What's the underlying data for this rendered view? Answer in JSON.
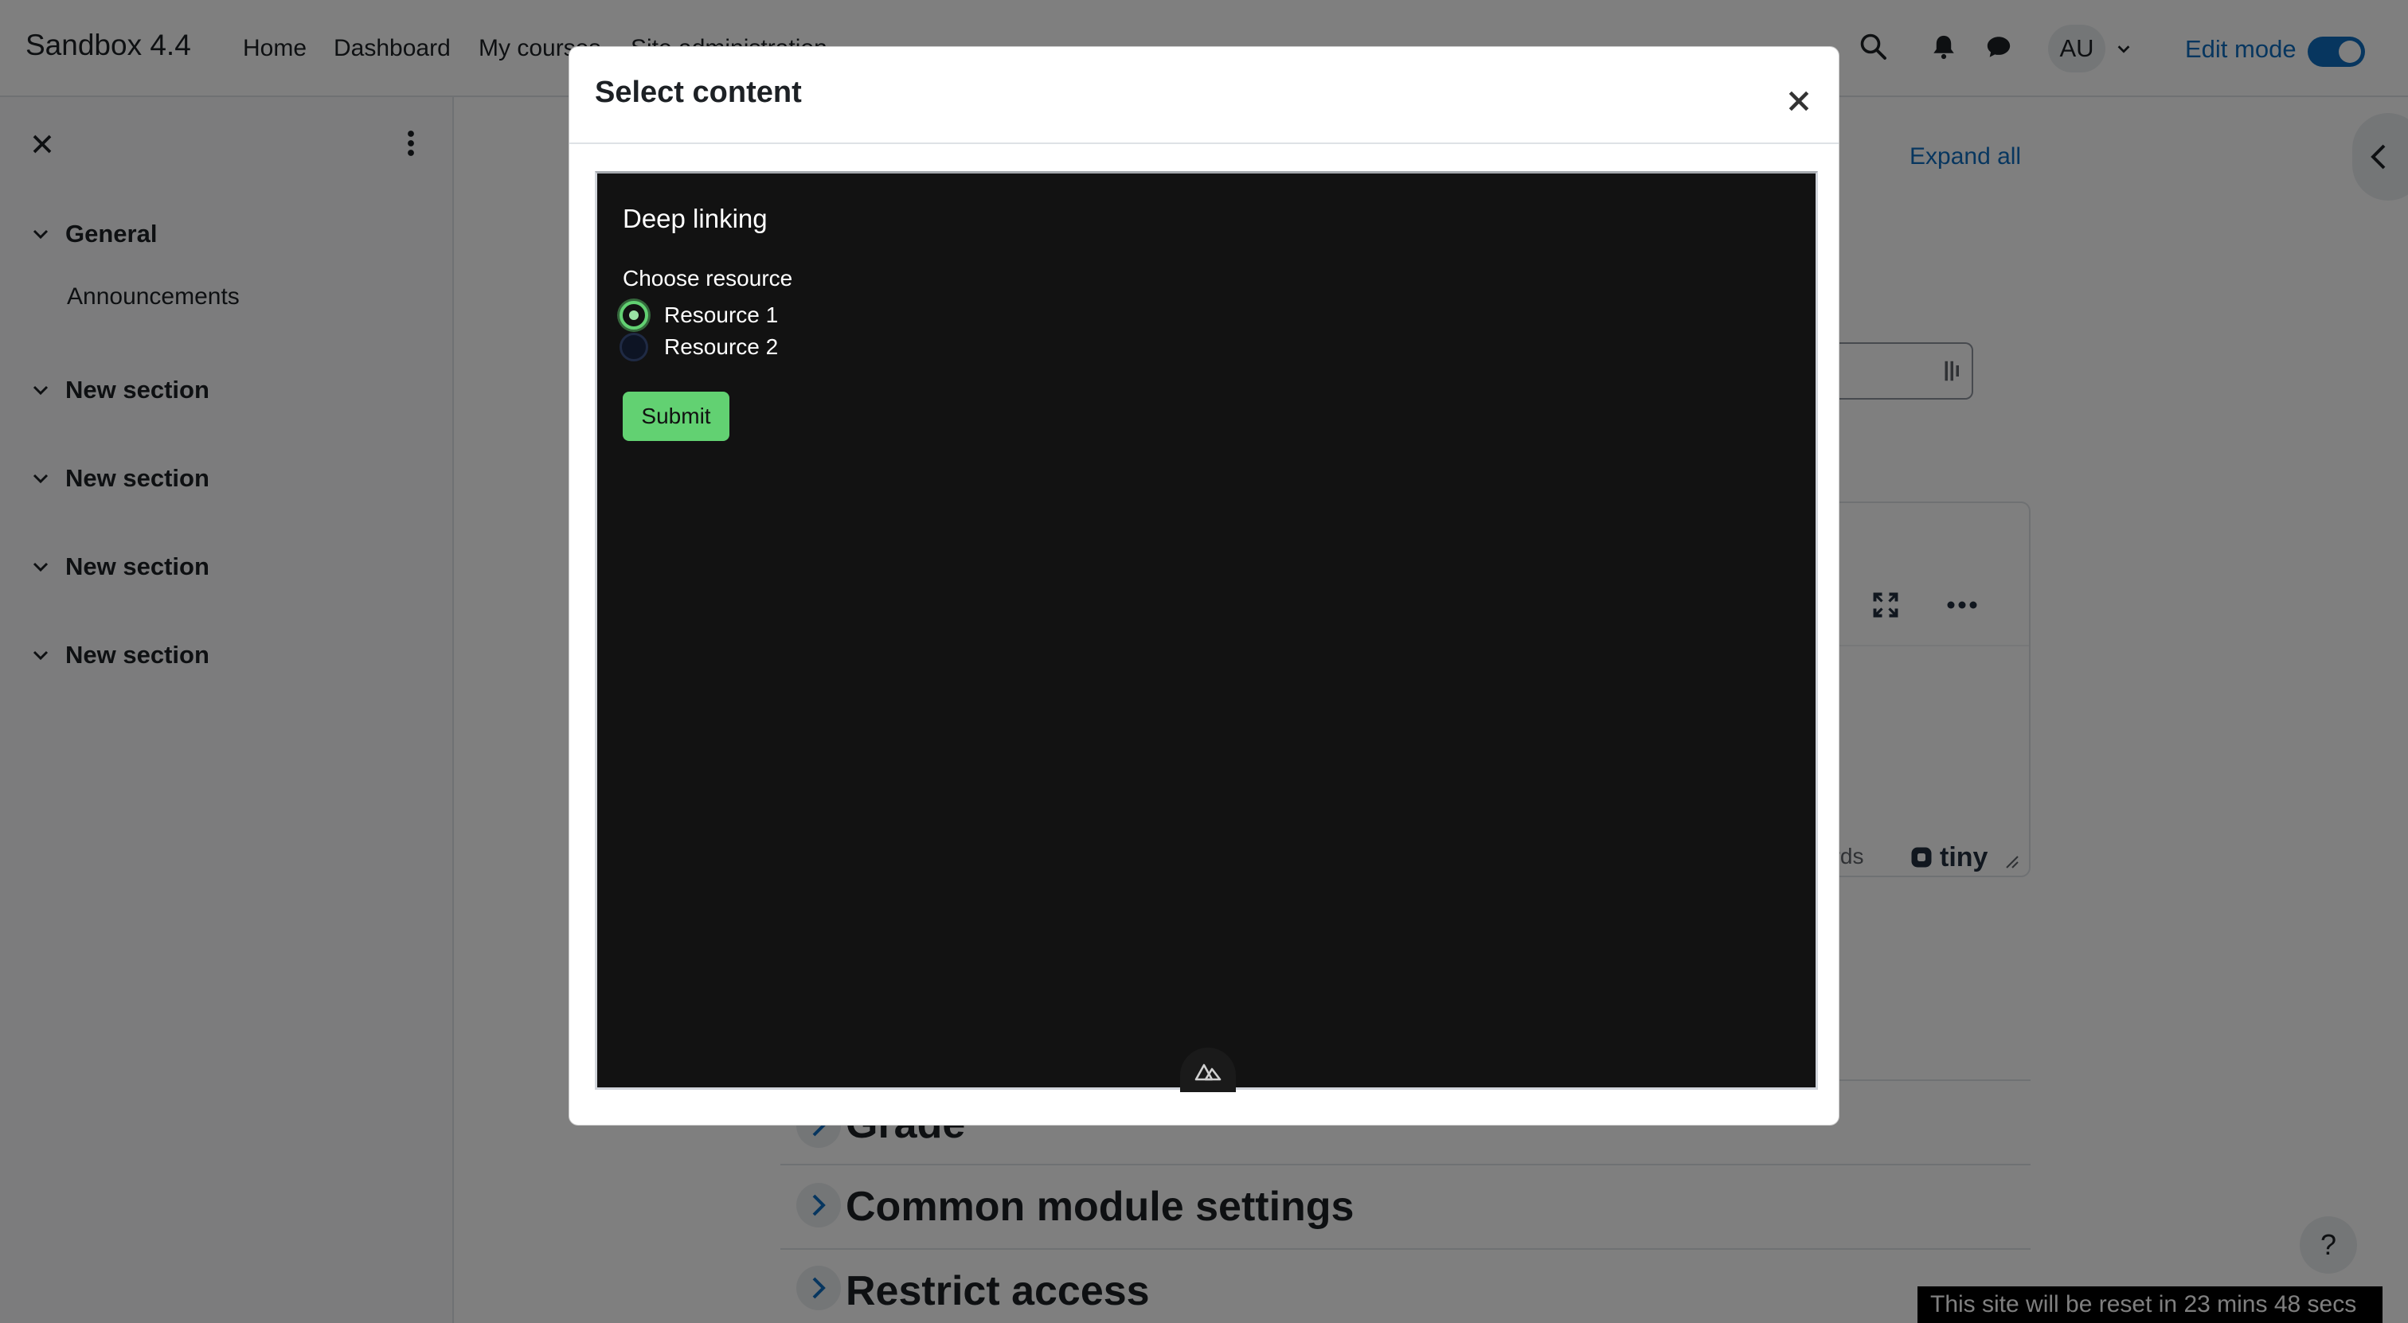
{
  "navbar": {
    "brand": "Sandbox 4.4",
    "links": [
      "Home",
      "Dashboard",
      "My courses",
      "Site administration"
    ],
    "avatar_initials": "AU",
    "edit_mode_label": "Edit mode"
  },
  "drawer": {
    "sections": [
      {
        "title": "General",
        "activities": [
          "Announcements"
        ]
      },
      {
        "title": "New section",
        "activities": []
      },
      {
        "title": "New section",
        "activities": []
      },
      {
        "title": "New section",
        "activities": []
      },
      {
        "title": "New section",
        "activities": []
      }
    ]
  },
  "main": {
    "expand_all_label": "Expand all",
    "editor_word_count_fragment": "ords",
    "editor_brand": "tiny",
    "collapsed_sections": [
      "Grade",
      "Common module settings",
      "Restrict access"
    ]
  },
  "help_label": "?",
  "reset_banner": "This site will be reset in 23 mins 48 secs",
  "modal": {
    "title": "Select content",
    "deep_linking": {
      "heading": "Deep linking",
      "legend": "Choose resource",
      "options": [
        {
          "label": "Resource 1",
          "checked": true
        },
        {
          "label": "Resource 2",
          "checked": false
        }
      ],
      "submit_label": "Submit"
    }
  },
  "colors": {
    "accent": "#0f6cbf",
    "submit_green": "#62d172",
    "iframe_bg": "#121212"
  }
}
